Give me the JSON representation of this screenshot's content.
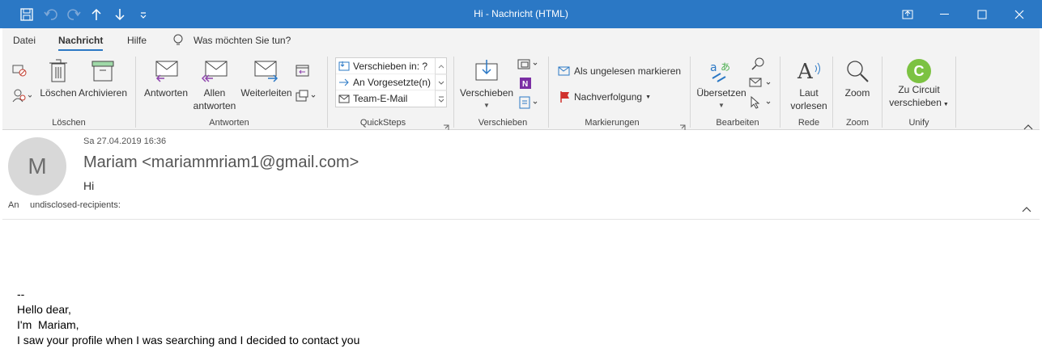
{
  "window": {
    "title": "Hi  -  Nachricht (HTML)"
  },
  "menubar": {
    "items": [
      "Datei",
      "Nachricht",
      "Hilfe"
    ],
    "tell_me": "Was möchten Sie tun?"
  },
  "ribbon": {
    "delete_group": {
      "label": "Löschen",
      "delete_btn": "Löschen",
      "archive_btn": "Archivieren"
    },
    "respond_group": {
      "label": "Antworten",
      "reply": "Antworten",
      "reply_all_1": "Allen",
      "reply_all_2": "antworten",
      "forward": "Weiterleiten"
    },
    "quicksteps": {
      "label": "QuickSteps",
      "items": [
        "Verschieben in: ?",
        "An Vorgesetzte(n)",
        "Team-E-Mail"
      ]
    },
    "move_group": {
      "label": "Verschieben",
      "move_btn": "Verschieben"
    },
    "tags_group": {
      "label": "Markierungen",
      "unread": "Als ungelesen markieren",
      "followup": "Nachverfolgung"
    },
    "edit_group": {
      "label": "Bearbeiten",
      "translate": "Übersetzen"
    },
    "speech_group": {
      "label": "Rede",
      "read_1": "Laut",
      "read_2": "vorlesen"
    },
    "zoom_group": {
      "label": "Zoom",
      "zoom_btn": "Zoom"
    },
    "unify_group": {
      "label": "Unify",
      "circuit_1": "Zu Circuit",
      "circuit_2": "verschieben",
      "circuit_initial": "C"
    }
  },
  "message": {
    "date": "Sa 27.04.2019 16:36",
    "avatar_initial": "M",
    "sender": "Mariam <mariammriam1@gmail.com>",
    "subject": "Hi",
    "to_label": "An",
    "to_value": "undisclosed-recipients:",
    "body": "--\nHello dear,\nI'm  Mariam,\nI saw your profile when I was searching and I decided to contact you"
  },
  "colors": {
    "titlebar": "#2b78c5",
    "accent": "#2b78c5",
    "circuit": "#7cc242",
    "followup_flag": "#d0312d",
    "onenote": "#7b2fa4"
  }
}
